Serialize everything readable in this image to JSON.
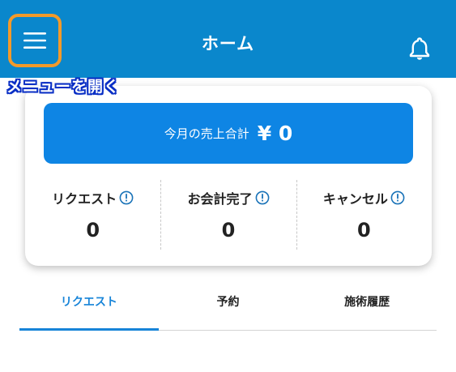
{
  "header": {
    "title": "ホーム",
    "menu_icon": "hamburger-menu-icon",
    "bell_icon": "bell-icon",
    "background_color": "#0a87cc",
    "highlight_color": "#f39a2a"
  },
  "annotation": {
    "text": "メニューを開く"
  },
  "summary": {
    "sales_label": "今月の売上合計",
    "sales_amount": "¥ 0",
    "banner_color": "#0e85e4",
    "stats": [
      {
        "label": "リクエスト",
        "value": "0"
      },
      {
        "label": "お会計完了",
        "value": "0"
      },
      {
        "label": "キャンセル",
        "value": "0"
      }
    ]
  },
  "tabs": [
    {
      "label": "リクエスト",
      "active": true
    },
    {
      "label": "予約",
      "active": false
    },
    {
      "label": "施術履歴",
      "active": false
    }
  ],
  "accent_color": "#1784d8"
}
